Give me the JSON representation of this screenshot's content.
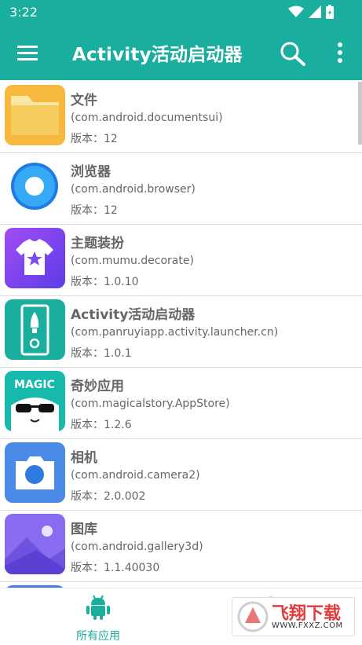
{
  "status_bar": {
    "time": "3:22"
  },
  "app_bar": {
    "title": "Activity活动启动器"
  },
  "apps": [
    {
      "name": "文件",
      "package": "(com.android.documentsui)",
      "version": "版本：12",
      "icon": "folder-icon",
      "color": "#f6c451"
    },
    {
      "name": "浏览器",
      "package": "(com.android.browser)",
      "version": "版本：12",
      "icon": "browser-icon",
      "color": "#1e88e5"
    },
    {
      "name": "主题装扮",
      "package": "(com.mumu.decorate)",
      "version": "版本：1.0.10",
      "icon": "tshirt-icon",
      "color": "#7b4cf0"
    },
    {
      "name": "Activity活动启动器",
      "package": "(com.panruyiapp.activity.launcher.cn)",
      "version": "版本：1.0.1",
      "icon": "rocket-icon",
      "color": "#1aae9f"
    },
    {
      "name": "奇妙应用",
      "package": "(com.magicalstory.AppStore)",
      "version": "版本：1.2.6",
      "icon": "magic-icon",
      "color": "#18b9ad"
    },
    {
      "name": "相机",
      "package": "(com.android.camera2)",
      "version": "版本：2.0.002",
      "icon": "camera-icon",
      "color": "#4a8be8"
    },
    {
      "name": "图库",
      "package": "(com.android.gallery3d)",
      "version": "版本：1.1.40030",
      "icon": "gallery-icon",
      "color": "#8567ee"
    }
  ],
  "bottom_nav": {
    "all_apps_label": "所有应用"
  },
  "watermark": {
    "text": "飞翔下载",
    "url": "WWW.FXXZ.COM"
  }
}
